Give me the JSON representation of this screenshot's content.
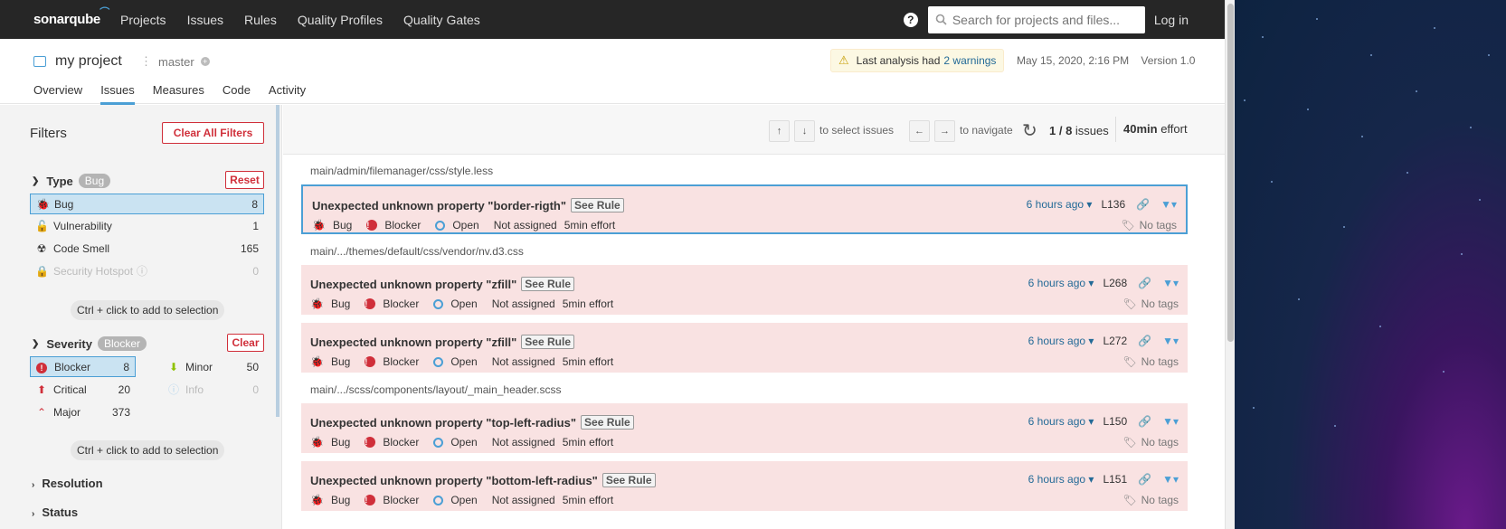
{
  "topnav": {
    "logo": "sonarqube",
    "links": [
      "Projects",
      "Issues",
      "Rules",
      "Quality Profiles",
      "Quality Gates"
    ],
    "search_placeholder": "Search for projects and files...",
    "login": "Log in"
  },
  "project": {
    "name": "my project",
    "branch": "master",
    "warning_text": "Last analysis had",
    "warning_link": "2 warnings",
    "date": "May 15, 2020, 2:16 PM",
    "version": "Version 1.0",
    "tabs": [
      "Overview",
      "Issues",
      "Measures",
      "Code",
      "Activity"
    ]
  },
  "sidebar": {
    "title": "Filters",
    "clear_all": "Clear All Filters",
    "type": {
      "label": "Type",
      "pill": "Bug",
      "reset": "Reset",
      "items": [
        {
          "label": "Bug",
          "count": "8"
        },
        {
          "label": "Vulnerability",
          "count": "1"
        },
        {
          "label": "Code Smell",
          "count": "165"
        },
        {
          "label": "Security Hotspot",
          "count": "0"
        }
      ]
    },
    "hint": "Ctrl + click to add to selection",
    "severity": {
      "label": "Severity",
      "pill": "Blocker",
      "clear": "Clear",
      "items": [
        {
          "label": "Blocker",
          "count": "8"
        },
        {
          "label": "Minor",
          "count": "50"
        },
        {
          "label": "Critical",
          "count": "20"
        },
        {
          "label": "Info",
          "count": "0"
        },
        {
          "label": "Major",
          "count": "373"
        }
      ]
    },
    "resolution": "Resolution",
    "status": "Status"
  },
  "toolbar": {
    "up": "↑",
    "down": "↓",
    "select_text": "to select issues",
    "left": "←",
    "right": "→",
    "nav_text": "to navigate",
    "count": "1 / 8",
    "count_suffix": "issues",
    "effort_value": "40min",
    "effort_suffix": "effort"
  },
  "issue_labels": {
    "see_rule": "See Rule",
    "type": "Bug",
    "severity": "Blocker",
    "status": "Open",
    "assignee": "Not assigned",
    "effort": "5min effort",
    "ago": "6 hours ago",
    "tags": "No tags"
  },
  "groups": [
    {
      "path": "main/admin/filemanager/css/style.less",
      "issues": [
        {
          "message": "Unexpected unknown property \"border-rigth\"",
          "line": "L136"
        }
      ]
    },
    {
      "path": "main/.../themes/default/css/vendor/nv.d3.css",
      "issues": [
        {
          "message": "Unexpected unknown property \"zfill\"",
          "line": "L268"
        },
        {
          "message": "Unexpected unknown property \"zfill\"",
          "line": "L272"
        }
      ]
    },
    {
      "path": "main/.../scss/components/layout/_main_header.scss",
      "issues": [
        {
          "message": "Unexpected unknown property \"top-left-radius\"",
          "line": "L150"
        },
        {
          "message": "Unexpected unknown property \"bottom-left-radius\"",
          "line": "L151"
        }
      ]
    }
  ],
  "colors": {
    "accent": "#4b9fd5",
    "danger": "#d02f3a",
    "issue_bg": "#f9e2e2",
    "nav_bg": "#262626"
  }
}
